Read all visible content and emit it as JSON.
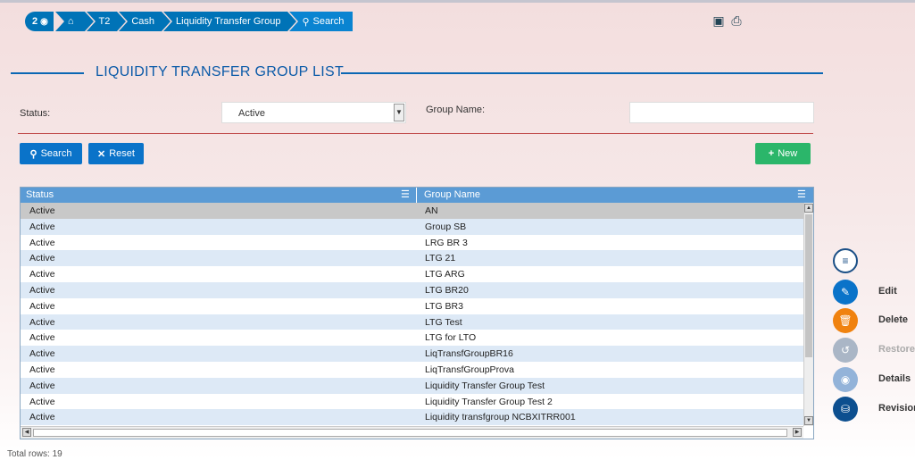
{
  "breadcrumb": {
    "counter": "2",
    "items": [
      "T2",
      "Cash",
      "Liquidity Transfer Group",
      "Search"
    ]
  },
  "page": {
    "title": "LIQUIDITY TRANSFER GROUP LIST"
  },
  "filters": {
    "status_label": "Status:",
    "status_value": "Active",
    "group_name_label": "Group Name:",
    "group_name_value": ""
  },
  "buttons": {
    "search": "Search",
    "reset": "Reset",
    "new": "New"
  },
  "table": {
    "columns": [
      "Status",
      "Group Name"
    ],
    "rows": [
      [
        "Active",
        "AN"
      ],
      [
        "Active",
        "Group SB"
      ],
      [
        "Active",
        "LRG BR 3"
      ],
      [
        "Active",
        "LTG 21"
      ],
      [
        "Active",
        "LTG ARG"
      ],
      [
        "Active",
        "LTG BR20"
      ],
      [
        "Active",
        "LTG BR3"
      ],
      [
        "Active",
        "LTG Test"
      ],
      [
        "Active",
        "LTG for LTO"
      ],
      [
        "Active",
        "LiqTransfGroupBR16"
      ],
      [
        "Active",
        "LiqTransfGroupProva"
      ],
      [
        "Active",
        "Liquidity Transfer Group Test"
      ],
      [
        "Active",
        "Liquidity Transfer Group Test 2"
      ],
      [
        "Active",
        "Liquidity transfgroup NCBXITRR001"
      ]
    ],
    "total_rows": "Total rows: 19"
  },
  "actions": {
    "edit": "Edit",
    "delete": "Delete",
    "restore": "Restore",
    "details": "Details",
    "revisions": "Revisions"
  },
  "colors": {
    "primary": "#0a73c9",
    "new": "#2bb66a",
    "delete": "#f0820f",
    "header": "#5b9bd5"
  }
}
